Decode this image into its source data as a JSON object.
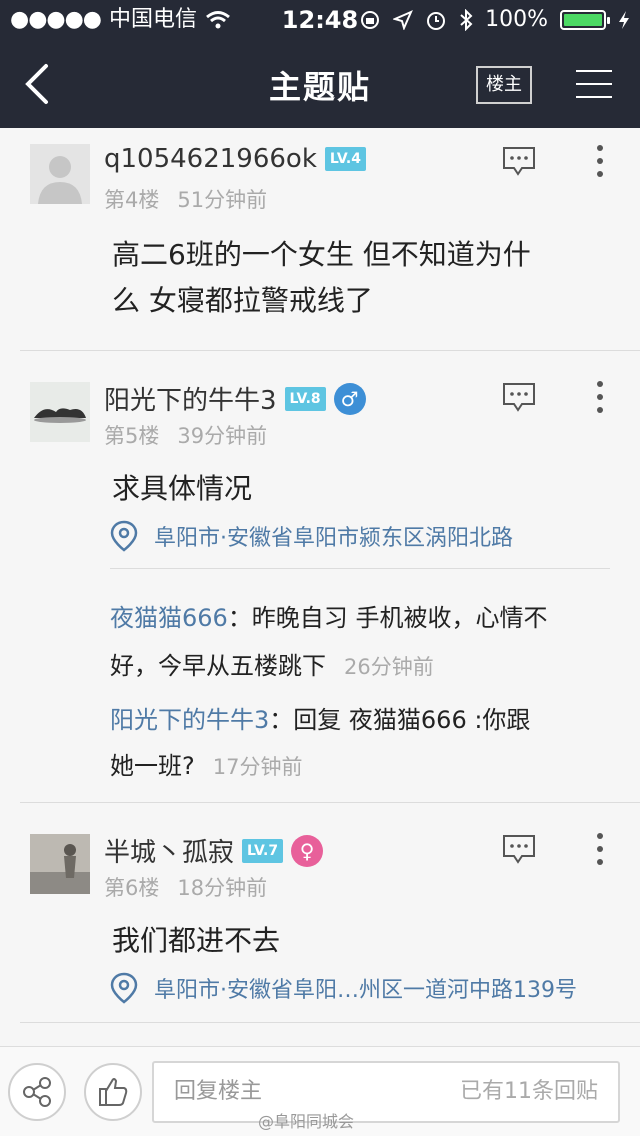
{
  "status_bar": {
    "signal": "●●●●●",
    "carrier": "中国电信",
    "time": "12:48",
    "battery": "100%"
  },
  "nav": {
    "title": "主题贴",
    "op_button": "楼主"
  },
  "posts": [
    {
      "user": "q1054621966ok",
      "level": "LV.4",
      "floor": "第4楼",
      "time": "51分钟前",
      "body_lines": [
        "高二6班的一个女生 但不知道为什",
        "么 女寝都拉警戒线了"
      ]
    },
    {
      "user": "阳光下的牛牛3",
      "level": "LV.8",
      "gender": "♂",
      "floor": "第5楼",
      "time": "39分钟前",
      "body_lines": [
        "求具体情况"
      ],
      "location": "阜阳市·安徽省阜阳市颍东区涡阳北路",
      "subreplies": [
        {
          "who": "夜猫猫666",
          "text_line1": "：昨晚自习 手机被收，心情不",
          "text_line2": "好，今早从五楼跳下",
          "time": "26分钟前"
        },
        {
          "who": "阳光下的牛牛3",
          "text_line1": "：回复 夜猫猫666 :你跟",
          "text_line2": "她一班?",
          "time": "17分钟前"
        }
      ]
    },
    {
      "user": "半城丶孤寂",
      "level": "LV.7",
      "gender": "♀",
      "floor": "第6楼",
      "time": "18分钟前",
      "body_lines": [
        "我们都进不去"
      ],
      "location": "阜阳市·安徽省阜阳…州区一道河中路139号"
    }
  ],
  "bottom_bar": {
    "placeholder": "回复楼主",
    "reply_count": "已有11条回贴"
  },
  "watermark": "@阜阳同城会",
  "colors": {
    "header_bg": "#262a36",
    "level_badge": "#5ec5e2",
    "male": "#3d8fd6",
    "female": "#e8609a",
    "link_blue": "#4f7aa6",
    "battery_green": "#4cd964"
  }
}
